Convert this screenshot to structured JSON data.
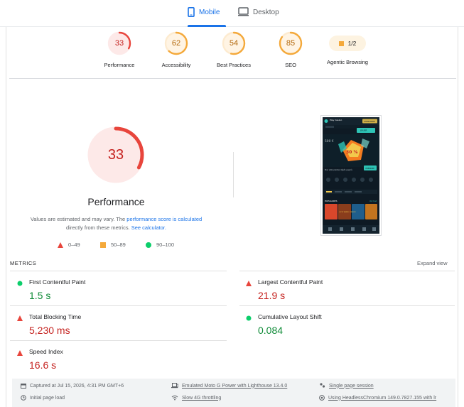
{
  "device_tabs": [
    {
      "label": "Mobile",
      "active": true,
      "icon": "smartphone-icon"
    },
    {
      "label": "Desktop",
      "active": false,
      "icon": "monitor-icon"
    }
  ],
  "categories": [
    {
      "score": "33",
      "label": "Performance",
      "fraction": 0.33,
      "status": "fail"
    },
    {
      "score": "62",
      "label": "Accessibility",
      "fraction": 0.62,
      "status": "average"
    },
    {
      "score": "54",
      "label": "Best Practices",
      "fraction": 0.54,
      "status": "average"
    },
    {
      "score": "85",
      "label": "SEO",
      "fraction": 0.85,
      "status": "average"
    },
    {
      "score": "1/2",
      "label": "Agentic Browsing",
      "status": "average"
    }
  ],
  "performance": {
    "score": "33",
    "fraction": 0.33,
    "title": "Performance",
    "note_1": "Values are estimated and may vary. The ",
    "note_link_1": "performance score is calculated",
    "note_2": "directly from these metrics. ",
    "note_link_2": "See calculator."
  },
  "legend": [
    {
      "range": "0–49",
      "shape": "triangle",
      "color": "#e8453c"
    },
    {
      "range": "50–89",
      "shape": "square",
      "color": "#f4a93b"
    },
    {
      "range": "90–100",
      "shape": "circle",
      "color": "#0cce6b"
    }
  ],
  "metrics": {
    "heading": "METRICS",
    "expand_label": "Expand view",
    "items": [
      {
        "name": "First Contentful Paint",
        "value": "1.5 s",
        "status": "pass"
      },
      {
        "name": "Largest Contentful Paint",
        "value": "21.9 s",
        "status": "fail"
      },
      {
        "name": "Total Blocking Time",
        "value": "5,230 ms",
        "status": "fail"
      },
      {
        "name": "Cumulative Layout Shift",
        "value": "0.084",
        "status": "pass"
      },
      {
        "name": "Speed Index",
        "value": "16.6 s",
        "status": "fail"
      }
    ]
  },
  "runtime": {
    "captured": "Captured at Jul 15, 2026, 4:31 PM GMT+6",
    "emulated": "Emulated Moto G Power with Lighthouse 13.4.0",
    "session": "Single page session",
    "initial_load": "Initial page load",
    "throttling": "Slow 4G throttling",
    "browser": "Using HeadlessChromium 149.0.7827.155 with lr"
  },
  "screenshot": {
    "header_logo": "Play Casino",
    "header_btn": "S'INSCRIRE",
    "promo_btn": "JOUER",
    "promo_amount": "500 €",
    "promo_badge": "30 %",
    "promo_caption": "Pour votre premier dépôt, jusqu'à",
    "promo_cta": "PRENDRE",
    "section_label": "POPULAIRES",
    "section_more": "Voir tout",
    "game_3_title": "LUCKY BARREL TAVERN"
  }
}
